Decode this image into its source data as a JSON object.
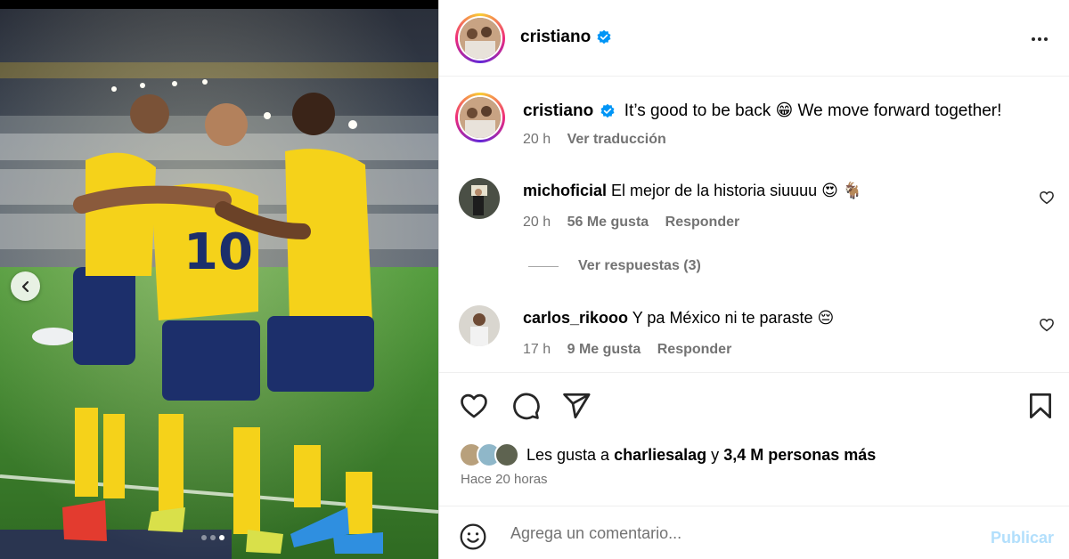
{
  "post": {
    "author": "cristiano",
    "caption": "It’s good to be back 😁 We move forward together!",
    "caption_time": "20 h",
    "translate_label": "Ver traducción"
  },
  "comments": [
    {
      "username": "michoficial",
      "text": "El mejor de la historia siuuuu 😍 🐐",
      "time": "20 h",
      "likes": "56 Me gusta",
      "reply_label": "Responder",
      "replies_label": "Ver respuestas (3)"
    },
    {
      "username": "carlos_rikooo",
      "text": "Y pa México ni te paraste 😔",
      "time": "17 h",
      "likes": "9 Me gusta",
      "reply_label": "Responder"
    }
  ],
  "likes": {
    "prefix": "Les gusta a",
    "user": "charliesalag",
    "joiner": "y",
    "others": "3,4 M personas más"
  },
  "time_ago": "Hace 20 horas",
  "add_comment": {
    "placeholder": "Agrega un comentario...",
    "publish_label": "Publicar"
  },
  "carousel": {
    "slides": 3,
    "active_index": 2
  },
  "icons": {
    "verified": "verified-badge-icon",
    "more": "more-options-icon",
    "like": "heart-icon",
    "comment": "comment-icon",
    "share": "share-icon",
    "save": "bookmark-icon",
    "emoji": "emoji-icon",
    "prev": "chevron-left-icon"
  },
  "colors": {
    "verified": "#0095f6",
    "publish_disabled": "#b2dffc",
    "muted_text": "#737373",
    "kit_yellow": "#f5d21a",
    "kit_navy": "#1c2f6b",
    "pitch_green": "#3f7d2c"
  }
}
